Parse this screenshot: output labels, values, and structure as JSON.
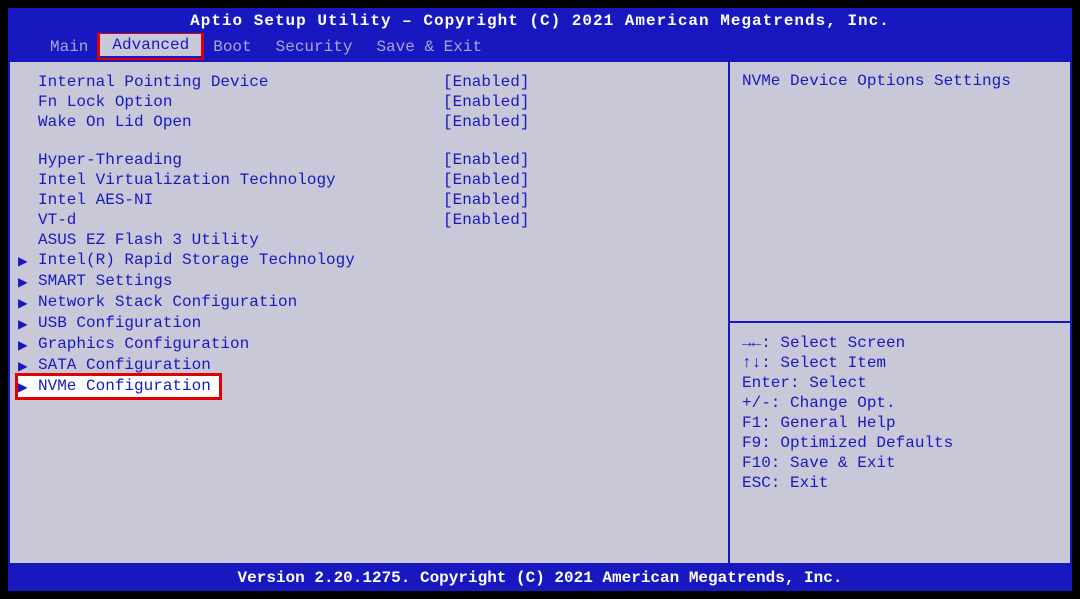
{
  "header": {
    "title": "Aptio Setup Utility – Copyright (C) 2021 American Megatrends, Inc."
  },
  "tabs": [
    {
      "label": "Main",
      "active": false,
      "highlighted": false
    },
    {
      "label": "Advanced",
      "active": true,
      "highlighted": true
    },
    {
      "label": "Boot",
      "active": false,
      "highlighted": false
    },
    {
      "label": "Security",
      "active": false,
      "highlighted": false
    },
    {
      "label": "Save & Exit",
      "active": false,
      "highlighted": false
    }
  ],
  "settings_group1": [
    {
      "label": "Internal Pointing Device",
      "value": "[Enabled]",
      "arrow": false
    },
    {
      "label": "Fn Lock Option",
      "value": "[Enabled]",
      "arrow": false
    },
    {
      "label": "Wake On Lid Open",
      "value": "[Enabled]",
      "arrow": false
    }
  ],
  "settings_group2": [
    {
      "label": "Hyper-Threading",
      "value": "[Enabled]",
      "arrow": false
    },
    {
      "label": "Intel Virtualization Technology",
      "value": "[Enabled]",
      "arrow": false
    },
    {
      "label": "Intel AES-NI",
      "value": "[Enabled]",
      "arrow": false
    },
    {
      "label": "VT-d",
      "value": "[Enabled]",
      "arrow": false
    },
    {
      "label": "ASUS EZ Flash 3 Utility",
      "value": "",
      "arrow": false
    },
    {
      "label": "Intel(R) Rapid Storage Technology",
      "value": "",
      "arrow": true
    },
    {
      "label": "SMART Settings",
      "value": "",
      "arrow": true
    },
    {
      "label": "Network Stack Configuration",
      "value": "",
      "arrow": true
    },
    {
      "label": "USB Configuration",
      "value": "",
      "arrow": true
    },
    {
      "label": "Graphics Configuration",
      "value": "",
      "arrow": true
    },
    {
      "label": "SATA Configuration",
      "value": "",
      "arrow": true
    }
  ],
  "selected_item": {
    "label": "NVMe Configuration",
    "arrow": true
  },
  "help": {
    "description": "NVMe Device Options Settings",
    "keys": [
      "→←: Select Screen",
      "↑↓: Select Item",
      "Enter: Select",
      "+/-: Change Opt.",
      "F1: General Help",
      "F9: Optimized Defaults",
      "F10: Save & Exit",
      "ESC: Exit"
    ]
  },
  "footer": {
    "text": "Version 2.20.1275. Copyright (C) 2021 American Megatrends, Inc."
  }
}
